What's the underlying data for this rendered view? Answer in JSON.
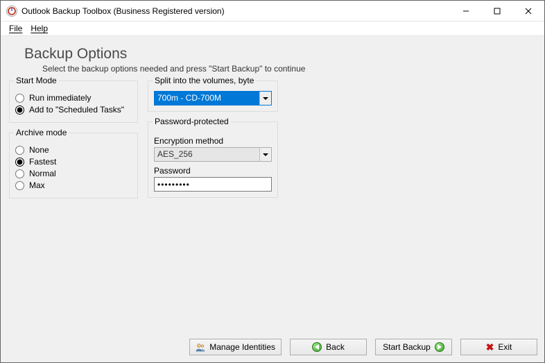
{
  "window": {
    "title": "Outlook Backup Toolbox (Business Registered version)"
  },
  "menubar": {
    "file": "File",
    "help": "Help"
  },
  "header": {
    "title": "Backup Options",
    "subtitle": "Select the backup options needed and press \"Start Backup\" to continue"
  },
  "startMode": {
    "legend": "Start Mode",
    "options": {
      "immediately": "Run immediately",
      "scheduled": "Add to \"Scheduled Tasks\""
    },
    "selected": "scheduled"
  },
  "archiveMode": {
    "legend": "Archive mode",
    "options": {
      "none": "None",
      "fastest": "Fastest",
      "normal": "Normal",
      "max": "Max"
    },
    "selected": "fastest"
  },
  "splitVolumes": {
    "legend": "Split into the volumes, byte",
    "value": "700m - CD-700M"
  },
  "passwordProtected": {
    "legend": "Password-protected",
    "encLabel": "Encryption method",
    "encValue": "AES_256",
    "pwdLabel": "Password",
    "pwdValue": "•••••••••"
  },
  "buttons": {
    "manage": "Manage Identities",
    "back": "Back",
    "start": "Start Backup",
    "exit": "Exit"
  }
}
